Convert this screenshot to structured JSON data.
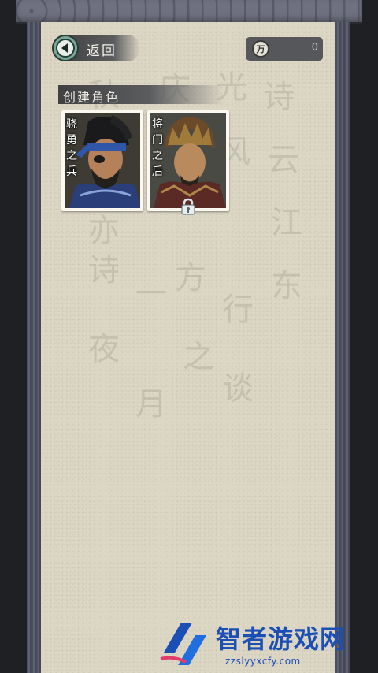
{
  "header": {
    "back_label": "返回",
    "currency_icon_glyph": "万",
    "currency_value": "0"
  },
  "section": {
    "title": "创建角色"
  },
  "characters": [
    {
      "name_lines": [
        "骁",
        "勇",
        "之",
        "兵"
      ],
      "locked": false
    },
    {
      "name_lines": [
        "将",
        "门",
        "之",
        "后"
      ],
      "locked": true
    }
  ],
  "background_calligraphy": [
    "诗",
    "云",
    "江",
    "东",
    "秋",
    "庆",
    "光",
    "风",
    "亦",
    "诗",
    "一",
    "方",
    "行",
    "之",
    "夜",
    "月",
    "谈"
  ],
  "watermark": {
    "text": "智者游戏网",
    "url": "zzslyyxcfy.com"
  },
  "colors": {
    "paper": "#dcd6c4",
    "frame": "#4b4f5e",
    "back_button_accent": "#7ca89a",
    "watermark_blue": "#1b4fb5"
  },
  "icons": [
    "back-arrow-icon",
    "coin-icon",
    "lock-icon",
    "watermark-logo-icon"
  ]
}
